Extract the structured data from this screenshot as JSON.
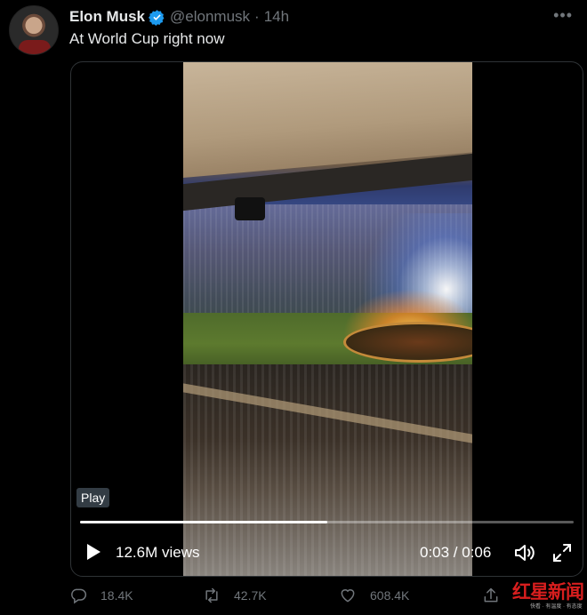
{
  "tweet": {
    "author_name": "Elon Musk",
    "handle": "@elonmusk",
    "separator": "·",
    "time": "14h",
    "text": "At World Cup right now"
  },
  "video": {
    "play_badge": "Play",
    "views": "12.6M views",
    "timecode": "0:03 / 0:06",
    "progress": 0.5
  },
  "actions": {
    "replies": "18.4K",
    "retweets": "42.7K",
    "likes": "608.4K"
  },
  "watermark": {
    "main": "红星新闻",
    "sub": "快看 · 有温度 · 有态度"
  },
  "colors": {
    "background": "#000000",
    "text_primary": "#e7e9ea",
    "text_secondary": "#71767b",
    "verified_blue": "#1d9bf0",
    "watermark_red": "#d81e1e"
  },
  "icons": {
    "verified": "verified-badge-icon",
    "more": "more-dots-icon",
    "play": "play-icon",
    "volume": "volume-icon",
    "fullscreen": "fullscreen-icon",
    "reply": "reply-icon",
    "retweet": "retweet-icon",
    "like": "heart-icon",
    "share": "share-icon"
  }
}
